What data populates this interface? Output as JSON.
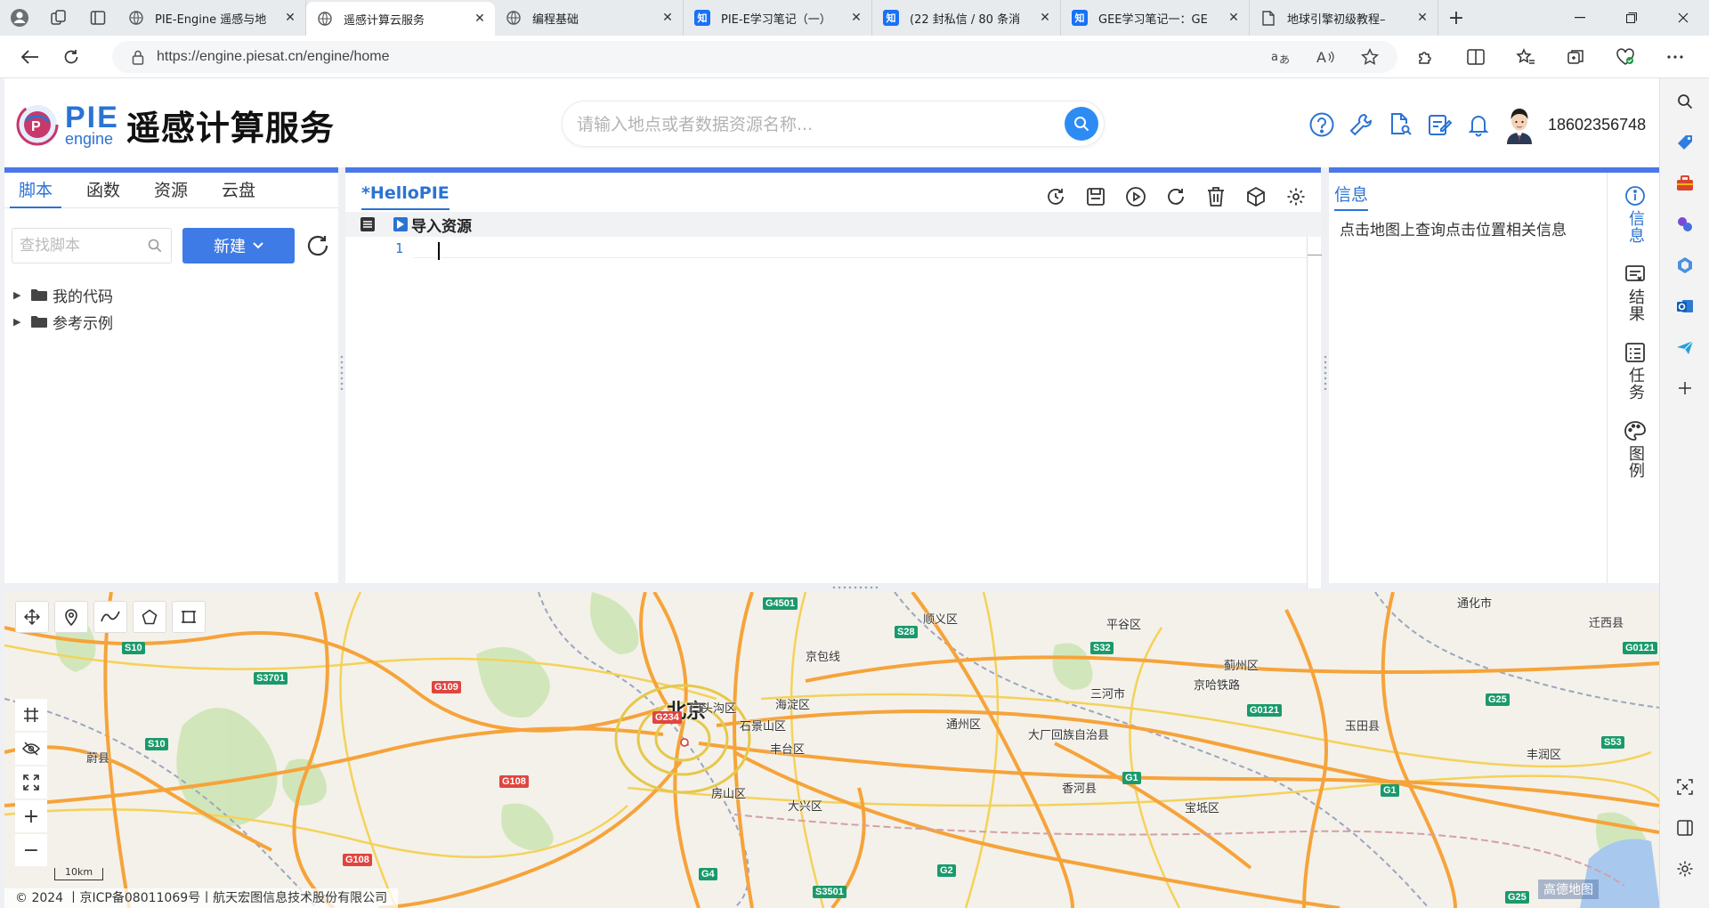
{
  "browser": {
    "tabs": [
      {
        "title": "PIE-Engine 遥感与地",
        "icon": "pie-globe-icon",
        "active": false
      },
      {
        "title": "遥感计算云服务",
        "icon": "pie-globe-icon",
        "active": true
      },
      {
        "title": "编程基础",
        "icon": "pie-globe-icon",
        "active": false
      },
      {
        "title": "PIE-E学习笔记（一）",
        "icon": "zhihu-icon",
        "active": false
      },
      {
        "title": "(22 封私信 / 80 条消",
        "icon": "zhihu-icon",
        "active": false
      },
      {
        "title": "GEE学习笔记一：GE",
        "icon": "zhihu-icon",
        "active": false
      },
      {
        "title": "地球引擎初级教程–",
        "icon": "document-icon",
        "active": false
      }
    ],
    "zhihu_glyph": "知",
    "url": "https://engine.piesat.cn/engine/home"
  },
  "header": {
    "logo_main": "PIE",
    "logo_sub": "engine",
    "service_title": "遥感计算服务",
    "search_placeholder": "请输入地点或者数据资源名称...",
    "phone": "18602356748"
  },
  "left_panel": {
    "tabs": [
      "脚本",
      "函数",
      "资源",
      "云盘"
    ],
    "active_tab": "脚本",
    "find_placeholder": "查找脚本",
    "new_button": "新建",
    "tree": [
      "我的代码",
      "参考示例"
    ]
  },
  "editor": {
    "title": "*HelloPIE",
    "import_label": "导入资源",
    "line_number": "1"
  },
  "info_panel": {
    "title": "信息",
    "text": "点击地图上查询点击位置相关信息",
    "side_tabs": [
      {
        "label": "信息",
        "icon": "info-icon",
        "active": true
      },
      {
        "label": "结果",
        "icon": "result-icon",
        "active": false
      },
      {
        "label": "任务",
        "icon": "task-icon",
        "active": false
      },
      {
        "label": "图例",
        "icon": "palette-icon",
        "active": false
      }
    ]
  },
  "map": {
    "scale_label": "10km",
    "copyright": "© 2024 丨京ICP备08011069号丨航天宏图信息技术股份有限公司",
    "provider": "高德地图",
    "city": "北京",
    "places": [
      "顺义区",
      "平谷区",
      "通化市",
      "迁西县",
      "蓟州区",
      "三河市",
      "门头沟区",
      "海淀区",
      "石景山区",
      "通州区",
      "大厂回族自治县",
      "玉田县",
      "丰台区",
      "房山区",
      "大兴区",
      "香河县",
      "宝坻区",
      "丰润区",
      "蔚县",
      "京哈铁路",
      "京包线"
    ],
    "shields": [
      "G4501",
      "S28",
      "S32",
      "G0121",
      "S10",
      "S3701",
      "G109",
      "G234",
      "G0121",
      "G25",
      "S10",
      "G108",
      "G1",
      "G1",
      "S53",
      "G108",
      "G4",
      "S3501",
      "G2",
      "G25"
    ]
  }
}
